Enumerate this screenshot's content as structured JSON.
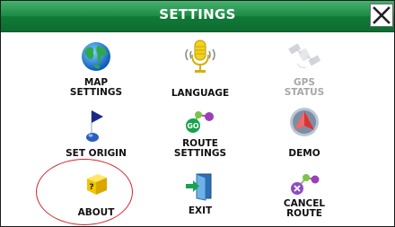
{
  "window": {
    "title": "SETTINGS",
    "close_icon": "close-x-icon"
  },
  "menu": [
    {
      "name": "map-settings-button",
      "label": "MAP\nSETTINGS",
      "icon": "globe-icon",
      "enabled": true
    },
    {
      "name": "language-button",
      "label": "LANGUAGE",
      "icon": "microphone-icon",
      "enabled": true
    },
    {
      "name": "gps-status-button",
      "label": "GPS\nSTATUS",
      "icon": "satellite-icon",
      "enabled": false
    },
    {
      "name": "set-origin-button",
      "label": "SET ORIGIN",
      "icon": "flag-icon",
      "enabled": true
    },
    {
      "name": "route-settings-button",
      "label": "ROUTE\nSETTINGS",
      "icon": "route-go-icon",
      "enabled": true
    },
    {
      "name": "demo-button",
      "label": "DEMO",
      "icon": "navigation-arrow-icon",
      "enabled": true
    },
    {
      "name": "about-button",
      "label": "ABOUT",
      "icon": "question-box-icon",
      "enabled": true
    },
    {
      "name": "exit-button",
      "label": "EXIT",
      "icon": "exit-door-icon",
      "enabled": true
    },
    {
      "name": "cancel-route-button",
      "label": "CANCEL\nROUTE",
      "icon": "cancel-route-icon",
      "enabled": true
    }
  ],
  "colors": {
    "titlebar": "#1a8a44",
    "highlight_circle": "#d9252d",
    "disabled_text": "#a7a7a7"
  }
}
